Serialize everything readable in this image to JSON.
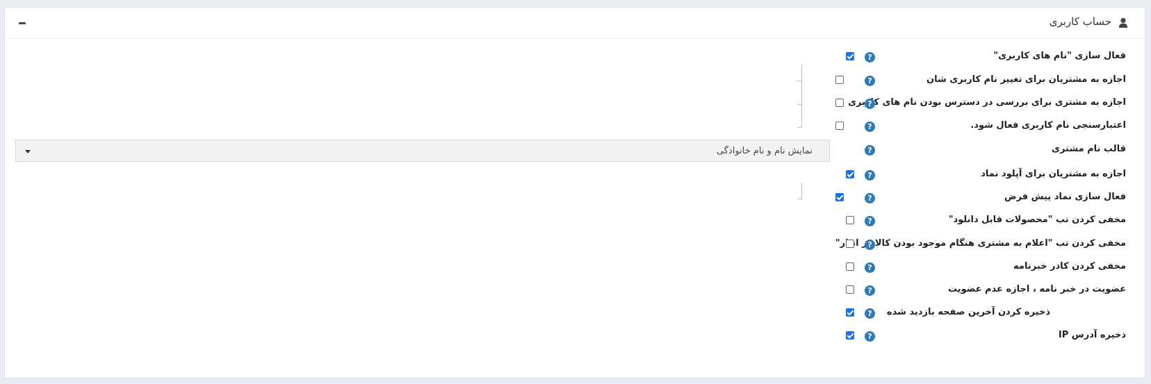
{
  "panel": {
    "title": "حساب کاربری",
    "icon": "user-icon",
    "collapse_icon": "minus-icon"
  },
  "settings": [
    {
      "label": "فعال سازی \"نام های کاربری\"",
      "checked": true,
      "level": 0
    },
    {
      "label": "اجازه به مشتریان برای تغییر نام کاربری شان",
      "checked": false,
      "level": 1
    },
    {
      "label": "اجازه به مشتری برای بررسی در دسترس بودن نام های کاربری",
      "checked": false,
      "level": 1
    },
    {
      "label": "اعتبارسنجی نام کاربری فعال شود.",
      "checked": false,
      "level": 1
    },
    {
      "label": "قالب نام مشتری",
      "type": "select",
      "value": "نمایش نام و نام خانوادگی"
    },
    {
      "label": "اجازه به مشتریان برای آپلود نماد",
      "checked": true,
      "level": 0
    },
    {
      "label": "فعال سازی نماد پیش فرض",
      "checked": true,
      "level": 1
    },
    {
      "label": "مخفی کردن تب \"محصولات قابل دانلود\"",
      "checked": false,
      "level": 0
    },
    {
      "label": "مخفی کردن تب \"اعلام به مشتری هنگام موجود بودن کالا در انبار\"",
      "checked": false,
      "level": 0
    },
    {
      "label": "مخفی کردن کادر خبرنامه",
      "checked": false,
      "level": 0
    },
    {
      "label": "عضویت در خبر نامه ، اجازه عدم عضویت",
      "checked": false,
      "level": 0
    },
    {
      "label": "ذخیره کردن آخرین صفحه بازدید شده",
      "checked": true,
      "level": 0
    },
    {
      "label": "ذخیره آدرس IP",
      "checked": true,
      "level": 0
    }
  ],
  "help_glyph": "?",
  "colors": {
    "accent": "#1a73e8",
    "help": "#2e7ab8"
  }
}
